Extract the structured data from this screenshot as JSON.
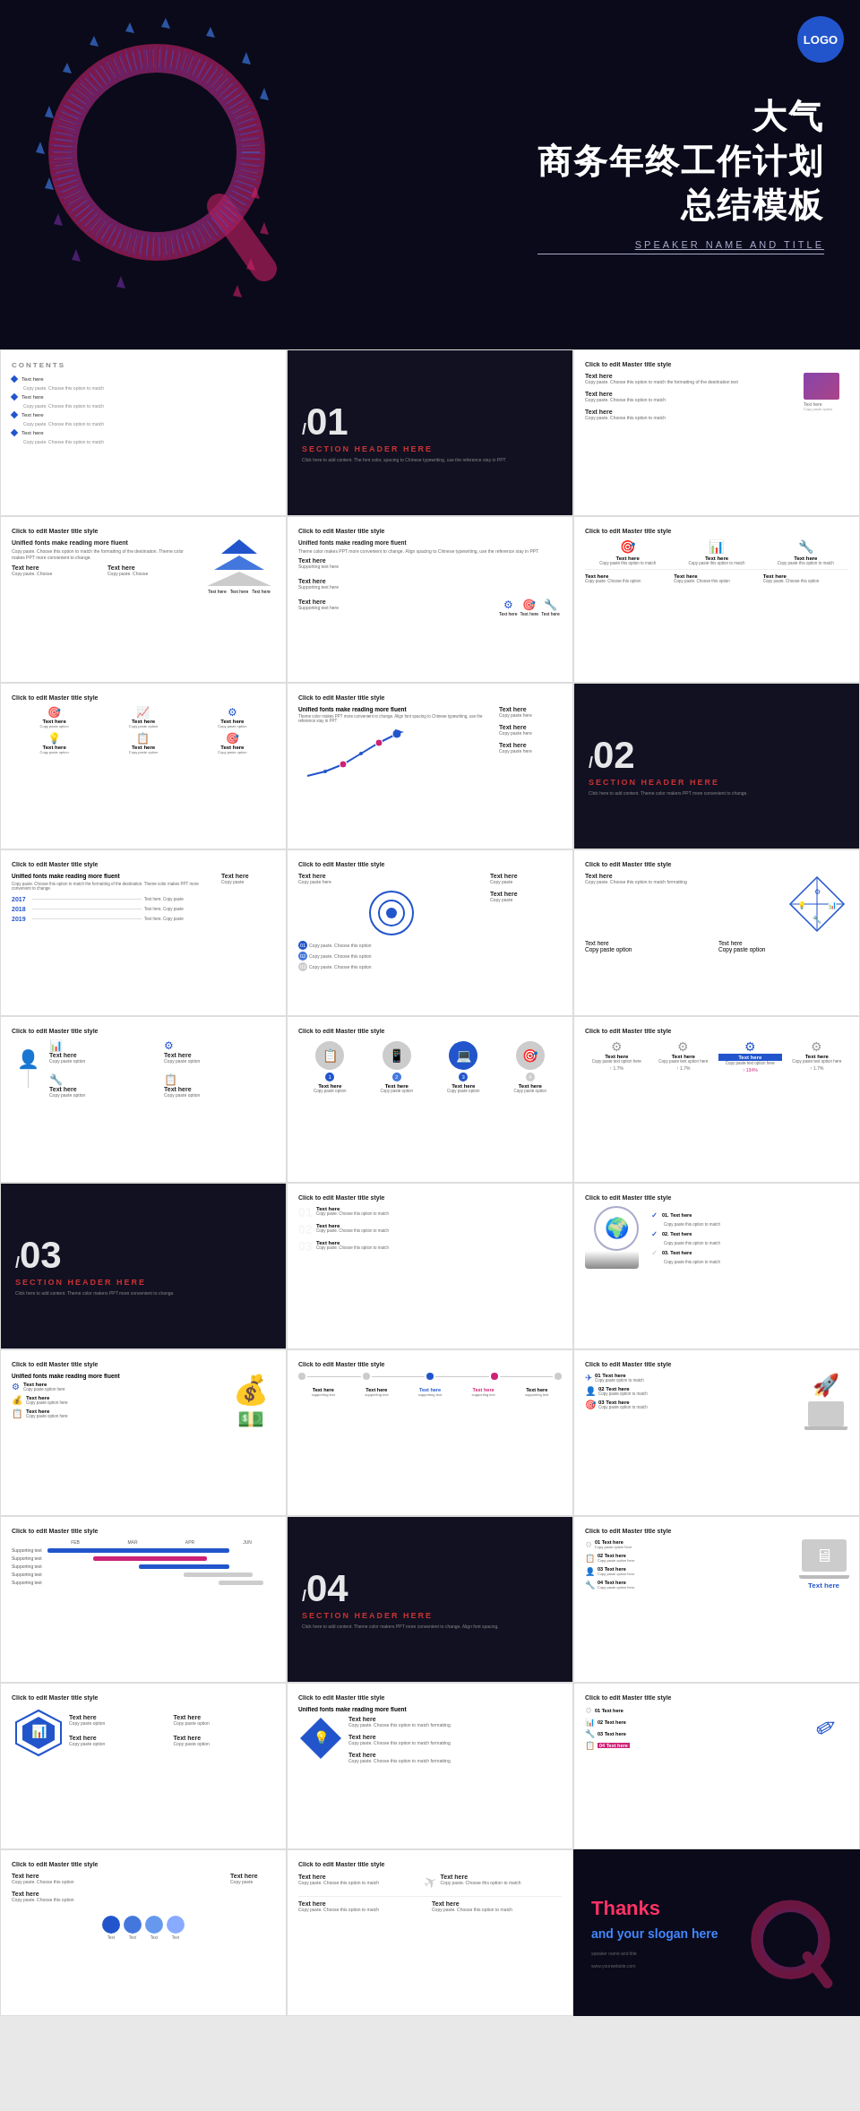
{
  "hero": {
    "logo": "LOGO",
    "title_line1": "大气",
    "title_line2": "商务年终工作计划",
    "title_line3": "总结模板",
    "speaker": "SPEAKER NAME AND TITLE"
  },
  "slides": {
    "contents": {
      "label": "CONTENTS",
      "items": [
        "Text here",
        "Text here",
        "Text here",
        "Text here"
      ]
    },
    "section01": {
      "num": "/01",
      "label": "SECTION HEADER HERE",
      "sub": "Click here to add content. The font color, spacing to Chinese typewriting, use the reference stay in PPT"
    },
    "section02": {
      "num": "/02",
      "label": "SECTION HEADER HERE",
      "sub": "Click here to add content. Theme color makers PPT more convenient to change."
    },
    "section03": {
      "num": "/03",
      "label": "SECTION HEADER HERE",
      "sub": "Click here to add content."
    },
    "section04": {
      "num": "/04",
      "label": "SECTION HEADER HERE",
      "sub": "Click here to add content."
    },
    "master_title": "Click to edit Master title style",
    "unified_fonts": "Unified fonts make reading more fluent",
    "text_here": "Text here",
    "text_body": "Copy paste. Choose this option to match the formatting of the destination.",
    "text_body2": "Text here. Copy paste this option to match the formatting of the destination.",
    "supporting": "Supporting text here.",
    "thanks": {
      "line1": "Thanks",
      "line2": "and your slogan here",
      "meta1": "speaker name and title",
      "meta2": "www.yourwebsite.com"
    }
  },
  "colors": {
    "blue": "#2255cc",
    "pink": "#cc2277",
    "dark": "#111122",
    "gray": "#999999",
    "light_gray": "#eeeeee"
  }
}
